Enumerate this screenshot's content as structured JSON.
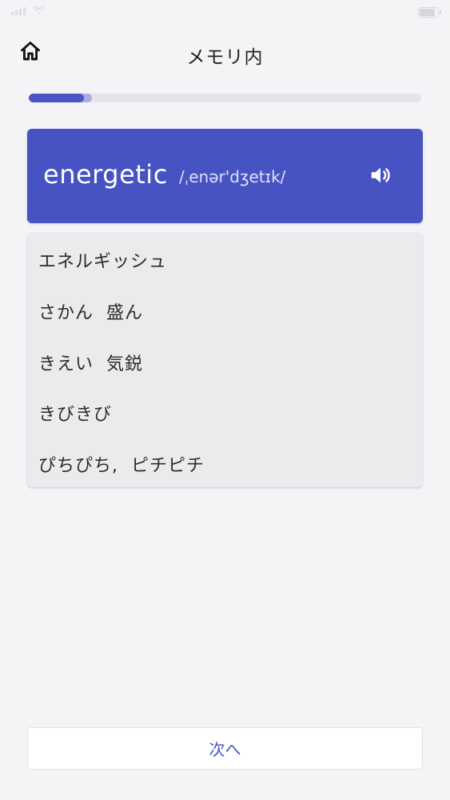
{
  "header": {
    "title": "メモリ内",
    "home_icon": "home-icon"
  },
  "progress": {
    "fraction": 0.14,
    "buffer_fraction": 0.16,
    "color": "#4a55c2",
    "buffer_color": "#a6ace0"
  },
  "card": {
    "word": "energetic",
    "ipa": "/ˌenər'dʒetɪk/",
    "speaker_icon": "speaker-icon",
    "color": "#4753c3"
  },
  "meanings": [
    "エネルギッシュ",
    "さかん  盛ん",
    "きえい  気鋭",
    "きびきび",
    "ぴちぴち,  ピチピチ"
  ],
  "footer": {
    "next_label": "次へ"
  }
}
